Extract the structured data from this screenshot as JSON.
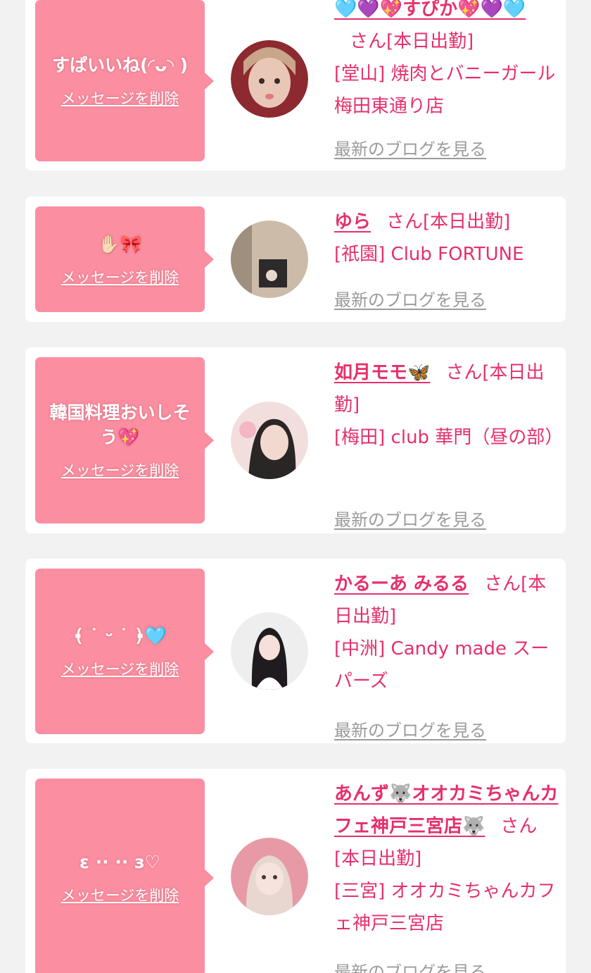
{
  "messages": [
    {
      "message": "すぱいいね(◜ᴗ◝ )",
      "delete_label": "メッセージを削除",
      "girl_name": "🩵💜💖すぴか💖💜🩵",
      "suffix": "さん[本日出勤]",
      "shop": "[堂山] 焼肉とバニーガール梅田東通り店",
      "blog_label": "最新のブログを見る"
    },
    {
      "message": "✋🏻🎀",
      "delete_label": "メッセージを削除",
      "girl_name": "ゆら",
      "suffix": "さん[本日出勤]",
      "shop": "[祇園] Club FORTUNE",
      "blog_label": "最新のブログを見る"
    },
    {
      "message": "韓国料理おいしそう💖",
      "delete_label": "メッセージを削除",
      "girl_name": "如月モモ🦋",
      "suffix": "さん[本日出勤]",
      "shop": "[梅田] club 華門（昼の部）",
      "blog_label": "最新のブログを見る"
    },
    {
      "message": "﴾ ˙ ᵕ ˙ ﴿🩵",
      "delete_label": "メッセージを削除",
      "girl_name": "かるーあ みるる",
      "suffix": "さん[本日出勤]",
      "shop": "[中洲] Candy made スーパーズ",
      "blog_label": "最新のブログを見る"
    },
    {
      "message": "ε ·· ·· з♡",
      "delete_label": "メッセージを削除",
      "girl_name": "あんず🐺オオカミちゃんカフェ神戸三宮店🐺",
      "suffix": "さん[本日出勤]",
      "shop": "[三宮] オオカミちゃんカフェ神戸三宮店",
      "blog_label": "最新のブログを見る"
    }
  ],
  "colors": {
    "background": "#f2f2f2",
    "bubble": "#fb8ea0",
    "accent": "#e6306b",
    "link_gray": "#9b9b9b"
  }
}
